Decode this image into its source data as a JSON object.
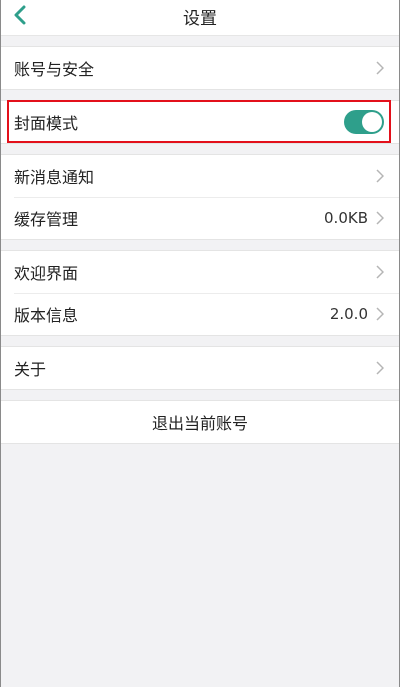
{
  "nav": {
    "title": "设置"
  },
  "sections": {
    "account": {
      "label": "账号与安全"
    },
    "cover": {
      "label": "封面模式",
      "enabled": true
    },
    "notify": {
      "label": "新消息通知"
    },
    "cache": {
      "label": "缓存管理",
      "value": "0.0KB"
    },
    "welcome": {
      "label": "欢迎界面"
    },
    "version": {
      "label": "版本信息",
      "value": "2.0.0"
    },
    "about": {
      "label": "关于"
    }
  },
  "logout": {
    "label": "退出当前账号"
  },
  "colors": {
    "accent": "#2e9f8b",
    "highlight": "#e3101b"
  }
}
